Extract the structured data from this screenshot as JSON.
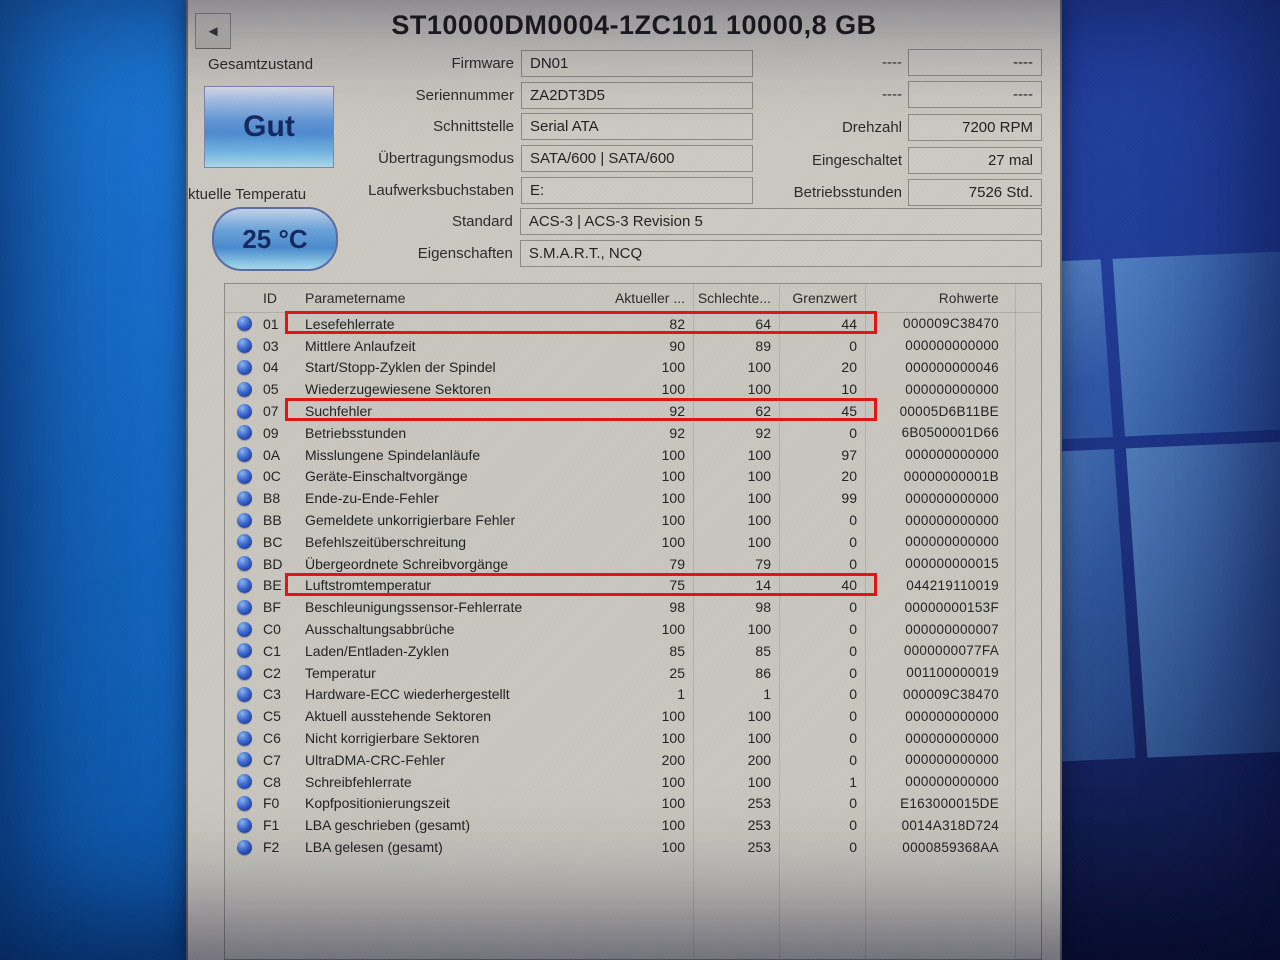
{
  "window_title": "ST10000DM0004-1ZC101 10000,8 GB",
  "icons": {
    "back_arrow": "◄"
  },
  "health": {
    "overall_label": "Gesamtzustand",
    "overall_status": "Gut",
    "temperature_label": "ktuelle Temperatu",
    "temperature_value": "25 °C"
  },
  "drive_info": {
    "fields": [
      {
        "label": "Firmware",
        "value": "DN01",
        "wide": false
      },
      {
        "label": "Seriennummer",
        "value": "ZA2DT3D5",
        "wide": false
      },
      {
        "label": "Schnittstelle",
        "value": "Serial ATA",
        "wide": false
      },
      {
        "label": "Übertragungsmodus",
        "value": "SATA/600 | SATA/600",
        "wide": false
      },
      {
        "label": "Laufwerksbuchstaben",
        "value": "E:",
        "wide": false
      },
      {
        "label": "Standard",
        "value": "ACS-3 | ACS-3 Revision 5",
        "wide": true
      },
      {
        "label": "Eigenschaften",
        "value": "S.M.A.R.T., NCQ",
        "wide": true
      }
    ]
  },
  "drive_stats": {
    "fields": [
      {
        "label": "----",
        "value": "----"
      },
      {
        "label": "----",
        "value": "----"
      },
      {
        "label": "Drehzahl",
        "value": "7200 RPM"
      },
      {
        "label": "Eingeschaltet",
        "value": "27 mal"
      },
      {
        "label": "Betriebsstunden",
        "value": "7526 Std."
      }
    ]
  },
  "smart_table": {
    "headers": {
      "id": "ID",
      "name": "Parametername",
      "current": "Aktueller ...",
      "worst": "Schlechte...",
      "threshold": "Grenzwert",
      "raw": "Rohwerte"
    },
    "highlighted_ids": [
      "01",
      "07",
      "BE"
    ],
    "rows": [
      {
        "id": "01",
        "name": "Lesefehlerrate",
        "current": "82",
        "worst": "64",
        "threshold": "44",
        "raw": "000009C38470"
      },
      {
        "id": "03",
        "name": "Mittlere Anlaufzeit",
        "current": "90",
        "worst": "89",
        "threshold": "0",
        "raw": "000000000000"
      },
      {
        "id": "04",
        "name": "Start/Stopp-Zyklen der Spindel",
        "current": "100",
        "worst": "100",
        "threshold": "20",
        "raw": "000000000046"
      },
      {
        "id": "05",
        "name": "Wiederzugewiesene Sektoren",
        "current": "100",
        "worst": "100",
        "threshold": "10",
        "raw": "000000000000"
      },
      {
        "id": "07",
        "name": "Suchfehler",
        "current": "92",
        "worst": "62",
        "threshold": "45",
        "raw": "00005D6B11BE"
      },
      {
        "id": "09",
        "name": "Betriebsstunden",
        "current": "92",
        "worst": "92",
        "threshold": "0",
        "raw": "6B0500001D66"
      },
      {
        "id": "0A",
        "name": "Misslungene Spindelanläufe",
        "current": "100",
        "worst": "100",
        "threshold": "97",
        "raw": "000000000000"
      },
      {
        "id": "0C",
        "name": "Geräte-Einschaltvorgänge",
        "current": "100",
        "worst": "100",
        "threshold": "20",
        "raw": "00000000001B"
      },
      {
        "id": "B8",
        "name": "Ende-zu-Ende-Fehler",
        "current": "100",
        "worst": "100",
        "threshold": "99",
        "raw": "000000000000"
      },
      {
        "id": "BB",
        "name": "Gemeldete unkorrigierbare Fehler",
        "current": "100",
        "worst": "100",
        "threshold": "0",
        "raw": "000000000000"
      },
      {
        "id": "BC",
        "name": "Befehlszeitüberschreitung",
        "current": "100",
        "worst": "100",
        "threshold": "0",
        "raw": "000000000000"
      },
      {
        "id": "BD",
        "name": "Übergeordnete Schreibvorgänge",
        "current": "79",
        "worst": "79",
        "threshold": "0",
        "raw": "000000000015"
      },
      {
        "id": "BE",
        "name": "Luftstromtemperatur",
        "current": "75",
        "worst": "14",
        "threshold": "40",
        "raw": "044219110019"
      },
      {
        "id": "BF",
        "name": "Beschleunigungssensor-Fehlerrate",
        "current": "98",
        "worst": "98",
        "threshold": "0",
        "raw": "00000000153F"
      },
      {
        "id": "C0",
        "name": "Ausschaltungsabbrüche",
        "current": "100",
        "worst": "100",
        "threshold": "0",
        "raw": "000000000007"
      },
      {
        "id": "C1",
        "name": "Laden/Entladen-Zyklen",
        "current": "85",
        "worst": "85",
        "threshold": "0",
        "raw": "0000000077FA"
      },
      {
        "id": "C2",
        "name": "Temperatur",
        "current": "25",
        "worst": "86",
        "threshold": "0",
        "raw": "001100000019"
      },
      {
        "id": "C3",
        "name": "Hardware-ECC wiederhergestellt",
        "current": "1",
        "worst": "1",
        "threshold": "0",
        "raw": "000009C38470"
      },
      {
        "id": "C5",
        "name": "Aktuell ausstehende Sektoren",
        "current": "100",
        "worst": "100",
        "threshold": "0",
        "raw": "000000000000"
      },
      {
        "id": "C6",
        "name": "Nicht korrigierbare Sektoren",
        "current": "100",
        "worst": "100",
        "threshold": "0",
        "raw": "000000000000"
      },
      {
        "id": "C7",
        "name": "UltraDMA-CRC-Fehler",
        "current": "200",
        "worst": "200",
        "threshold": "0",
        "raw": "000000000000"
      },
      {
        "id": "C8",
        "name": "Schreibfehlerrate",
        "current": "100",
        "worst": "100",
        "threshold": "1",
        "raw": "000000000000"
      },
      {
        "id": "F0",
        "name": "Kopfpositionierungszeit",
        "current": "100",
        "worst": "253",
        "threshold": "0",
        "raw": "E163000015DE"
      },
      {
        "id": "F1",
        "name": "LBA geschrieben (gesamt)",
        "current": "100",
        "worst": "253",
        "threshold": "0",
        "raw": "0014A318D724"
      },
      {
        "id": "F2",
        "name": "LBA gelesen (gesamt)",
        "current": "100",
        "worst": "253",
        "threshold": "0",
        "raw": "0000859368AA"
      }
    ]
  },
  "colors": {
    "annotation_red": "#e01515",
    "status_navy": "#16295e",
    "desktop_blue": "#1668c4",
    "window_gray": "#ccc8c2"
  }
}
